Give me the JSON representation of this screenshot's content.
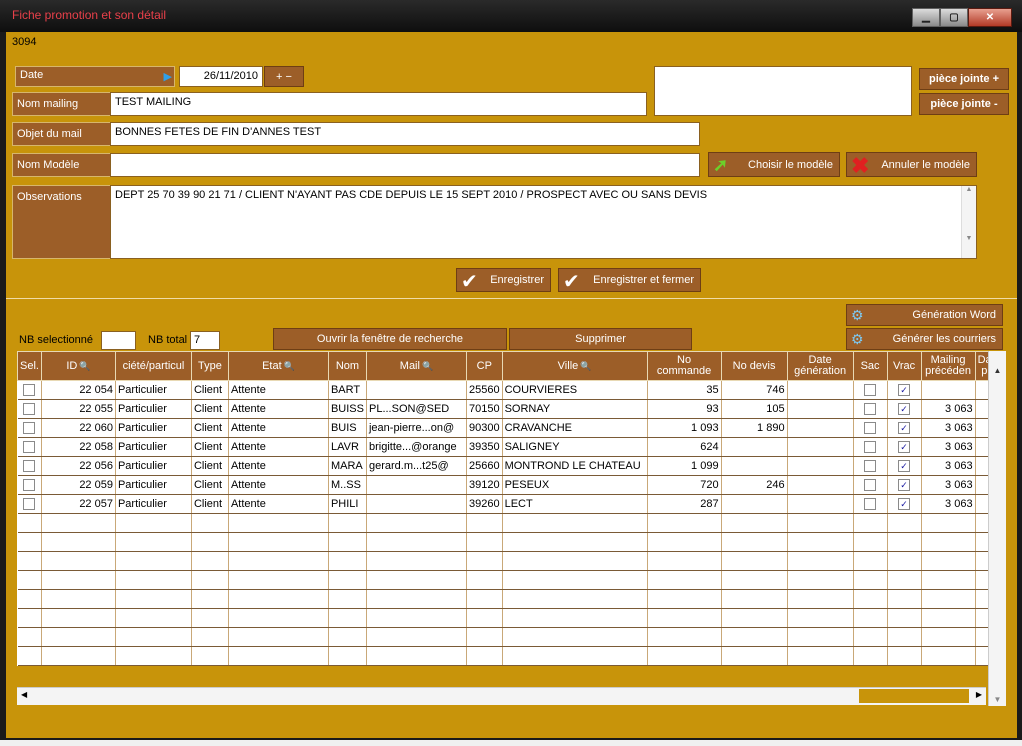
{
  "window": {
    "title": "Fiche promotion et son détail"
  },
  "record_id": "3094",
  "form": {
    "date_label": "Date",
    "date_value": "26/11/2010",
    "date_plus": "+",
    "date_minus": "−",
    "nom_mailing_label": "Nom mailing",
    "nom_mailing_value": "TEST MAILING",
    "objet_label": "Objet du mail",
    "objet_value": "BONNES FETES DE FIN D'ANNES TEST",
    "modele_label": "Nom Modèle",
    "modele_value": "",
    "observations_label": "Observations",
    "observations_value": "DEPT 25 70 39 90 21 71 / CLIENT N'AYANT PAS CDE DEPUIS LE 15 SEPT 2010 / PROSPECT AVEC OU SANS DEVIS"
  },
  "buttons": {
    "piece_jointe_plus": "pièce jointe +",
    "piece_jointe_minus": "pièce jointe -",
    "choisir_modele": "Choisir le modèle",
    "annuler_modele": "Annuler le modèle",
    "enregistrer": "Enregistrer",
    "enregistrer_fermer": "Enregistrer et fermer",
    "generation_word": "Génération Word",
    "generer_courriers": "Générer les courriers",
    "ouvrir_recherche": "Ouvrir la fenêtre de recherche",
    "supprimer": "Supprimer"
  },
  "counts": {
    "nb_selectionne_label": "NB selectionné",
    "nb_selectionne_value": "",
    "nb_total_label": "NB total",
    "nb_total_value": "7"
  },
  "table": {
    "headers": [
      "Sel.",
      "ID",
      "ciété/particul",
      "Type",
      "Etat",
      "Nom",
      "Mail",
      "CP",
      "Ville",
      "No commande",
      "No devis",
      "Date génération",
      "Sac",
      "Vrac",
      "Mailing précéden",
      "Date pré"
    ],
    "rows": [
      {
        "id": "22 054",
        "societe": "Particulier",
        "type": "Client",
        "etat": "Attente",
        "nom": "BART",
        "mail": "",
        "cp": "25560",
        "ville": "COURVIERES",
        "commande": "35",
        "devis": "746",
        "date_gen": "",
        "sac": false,
        "vrac": true,
        "mailing": "",
        "date_pre": ""
      },
      {
        "id": "22 055",
        "societe": "Particulier",
        "type": "Client",
        "etat": "Attente",
        "nom": "BUISS",
        "mail": "PL...SON@SED",
        "cp": "70150",
        "ville": "SORNAY",
        "commande": "93",
        "devis": "105",
        "date_gen": "",
        "sac": false,
        "vrac": true,
        "mailing": "3 063",
        "date_pre": ""
      },
      {
        "id": "22 060",
        "societe": "Particulier",
        "type": "Client",
        "etat": "Attente",
        "nom": "BUIS",
        "mail": "jean-pierre...on@",
        "cp": "90300",
        "ville": "CRAVANCHE",
        "commande": "1 093",
        "devis": "1 890",
        "date_gen": "",
        "sac": false,
        "vrac": true,
        "mailing": "3 063",
        "date_pre": ""
      },
      {
        "id": "22 058",
        "societe": "Particulier",
        "type": "Client",
        "etat": "Attente",
        "nom": "LAVR",
        "mail": "brigitte...@orange",
        "cp": "39350",
        "ville": "SALIGNEY",
        "commande": "624",
        "devis": "",
        "date_gen": "",
        "sac": false,
        "vrac": true,
        "mailing": "3 063",
        "date_pre": ""
      },
      {
        "id": "22 056",
        "societe": "Particulier",
        "type": "Client",
        "etat": "Attente",
        "nom": "MARA",
        "mail": "gerard.m...t25@",
        "cp": "25660",
        "ville": "MONTROND LE CHATEAU",
        "commande": "1 099",
        "devis": "",
        "date_gen": "",
        "sac": false,
        "vrac": true,
        "mailing": "3 063",
        "date_pre": ""
      },
      {
        "id": "22 059",
        "societe": "Particulier",
        "type": "Client",
        "etat": "Attente",
        "nom": "M..SS",
        "mail": "",
        "cp": "39120",
        "ville": "PESEUX",
        "commande": "720",
        "devis": "246",
        "date_gen": "",
        "sac": false,
        "vrac": true,
        "mailing": "3 063",
        "date_pre": ""
      },
      {
        "id": "22 057",
        "societe": "Particulier",
        "type": "Client",
        "etat": "Attente",
        "nom": "PHILI",
        "mail": "",
        "cp": "39260",
        "ville": "LECT",
        "commande": "287",
        "devis": "",
        "date_gen": "",
        "sac": false,
        "vrac": true,
        "mailing": "3 063",
        "date_pre": ""
      }
    ]
  }
}
